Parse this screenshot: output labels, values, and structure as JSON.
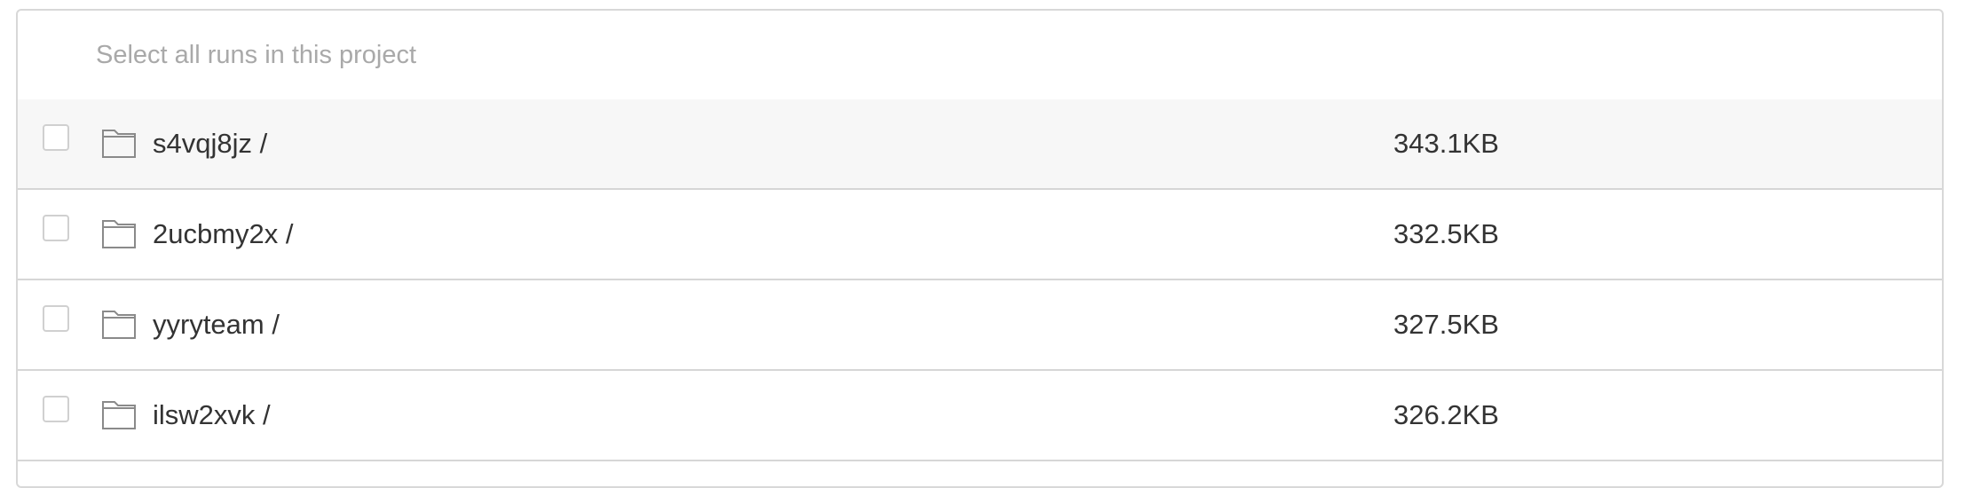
{
  "select_all": {
    "label": "Select all runs in this project"
  },
  "rows": [
    {
      "name": "s4vqj8jz /",
      "size": "343.1KB",
      "icon": "folder-icon"
    },
    {
      "name": "2ucbmy2x /",
      "size": "332.5KB",
      "icon": "folder-icon"
    },
    {
      "name": "yyryteam /",
      "size": "327.5KB",
      "icon": "folder-icon"
    },
    {
      "name": "ilsw2xvk /",
      "size": "326.2KB",
      "icon": "folder-icon"
    }
  ],
  "colors": {
    "border": "#d8d8d8",
    "highlight_row": "#f7f7f7",
    "text": "#333333",
    "muted_text": "#a9a9a9",
    "folder_stroke": "#8a8a8a"
  }
}
